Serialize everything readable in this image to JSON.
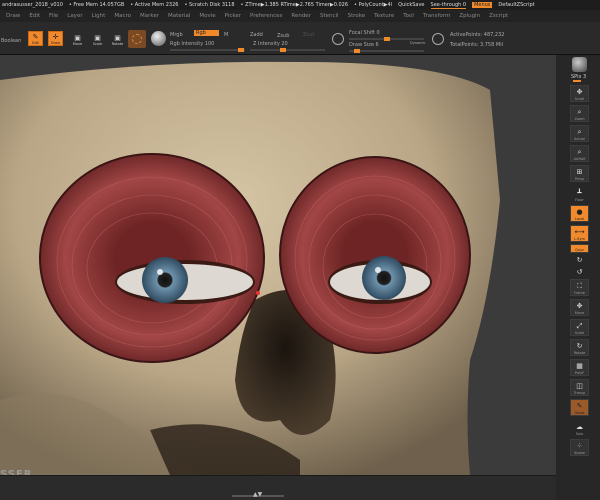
{
  "titlebar": {
    "doc": "andrasusser_2018_v010",
    "free_mem": "• Free Mem 14.057GB",
    "active_mem": "• Active Mem 2326",
    "scratch": "• Scratch Disk 3118",
    "timers": "• ZTime▶1.385 RTime▶2.765 Timer▶0.026",
    "polycount": "• PolyCount▶4l",
    "quicksave": "QuickSave",
    "see_through": "See-through  0",
    "menus": "Menus",
    "default_script": "DefaultZScript"
  },
  "menu": [
    "Draw",
    "Edit",
    "File",
    "Layer",
    "Light",
    "Macro",
    "Marker",
    "Material",
    "Movie",
    "Picker",
    "Preferences",
    "Render",
    "Stencil",
    "Stroke",
    "Texture",
    "Tool",
    "Transform",
    "Zplugin",
    "Zscript"
  ],
  "toolbar": {
    "boolean": "Boolean",
    "edit": "Edit",
    "draw": "Draw",
    "move": "Move",
    "scale": "Scale",
    "rotate": "Rotate",
    "mrgb": "Mrgb",
    "rgb": "Rgb",
    "m": "M",
    "rgb_intensity": "Rgb Intensity 100",
    "rgb_intensity_value": 100,
    "zadd": "Zadd",
    "zsub": "Zsub",
    "zcut": "Zcut",
    "z_intensity": "Z Intensity 20",
    "z_intensity_value": 20,
    "focal_shift": "Focal Shift 0",
    "focal_shift_value": 0,
    "draw_size": "Draw Size 6",
    "draw_size_value": 6,
    "dynamic": "Dynamic",
    "active_points": "ActivePoints: 487,232",
    "total_points": "TotalPoints: 3.758 Mil"
  },
  "shelf": [
    {
      "label": "SPix 3"
    },
    {
      "label": "Scroll",
      "icon": "scroll-icon"
    },
    {
      "label": "Zoom",
      "icon": "zoom-icon"
    },
    {
      "label": "Actual",
      "icon": "actual-icon"
    },
    {
      "label": "AAHalf",
      "icon": "aahalf-icon"
    },
    {
      "label": "Persp",
      "icon": "perspective-icon"
    },
    {
      "label": "Floor",
      "icon": "floor-icon"
    },
    {
      "label": "Local",
      "icon": "local-icon",
      "active": true
    },
    {
      "label": "L.Sym",
      "icon": "lsym-icon",
      "active": true
    },
    {
      "label": "Qxyz",
      "icon": "xyz-icon",
      "active": true
    },
    {
      "label": "Frame",
      "icon": "frame-icon"
    },
    {
      "label": "Move",
      "icon": "move-icon"
    },
    {
      "label": "Scale",
      "icon": "scale-icon"
    },
    {
      "label": "Rotate",
      "icon": "rotate-icon"
    },
    {
      "label": "PolyF",
      "icon": "polyframe-icon"
    },
    {
      "label": "Transp",
      "icon": "transparency-icon"
    },
    {
      "label": "Ghost",
      "icon": "ghost-icon",
      "active": true
    },
    {
      "label": "Solo",
      "icon": "solo-icon"
    },
    {
      "label": "Xpose",
      "icon": "xpose-icon"
    }
  ],
  "watermark": "SSER",
  "colors": {
    "accent": "#f0892a",
    "bone": "#c8b797",
    "muscle": "#9a3a3a",
    "background": "#3b3b3b"
  }
}
